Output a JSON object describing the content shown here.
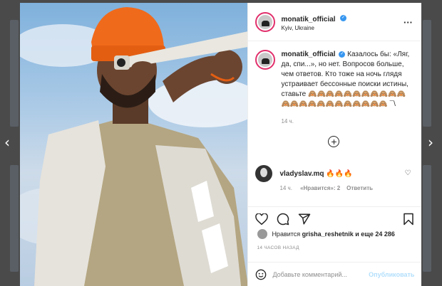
{
  "post": {
    "username": "monatik_official",
    "location": "Kyiv, Ukraine",
    "caption": "Казалось бы: «Ляг, да, спи...», но нет. Вопросов больше, чем ответов. Кто тоже на ночь глядя устраивает бессонные поиски истины, ставьте 🙈🙈🙈🙈🙈🙈🙈🙈🙈🙈🙈🙈🙈🙈🙈🙈🙈🙈🙈🙈🙈🙈🙈 ¯\\",
    "caption_time": "14 ч.",
    "more_label": "···"
  },
  "comments": [
    {
      "username": "vladyslav.mq",
      "text": "🔥🔥🔥",
      "time": "14 ч.",
      "likes": "«Нравится»: 2",
      "reply": "Ответить"
    }
  ],
  "likes": {
    "prefix": "Нравится",
    "user": "grisha_reshetnik",
    "suffix": "и еще 24 286"
  },
  "timestamp": "14 ЧАСОВ НАЗАД",
  "comment_box": {
    "placeholder": "Добавьте комментарий...",
    "publish": "Опубликовать"
  },
  "nav": {
    "prev": "‹",
    "next": "›"
  },
  "colors": {
    "accent": "#3897f0",
    "story_ring": "#e1306c",
    "hat": "#f06a1b",
    "coat": "#b4a682"
  },
  "icons": [
    "heart-icon",
    "comment-icon",
    "share-icon",
    "bookmark-icon",
    "emoji-icon",
    "verified-badge-icon",
    "add-comments-icon"
  ]
}
